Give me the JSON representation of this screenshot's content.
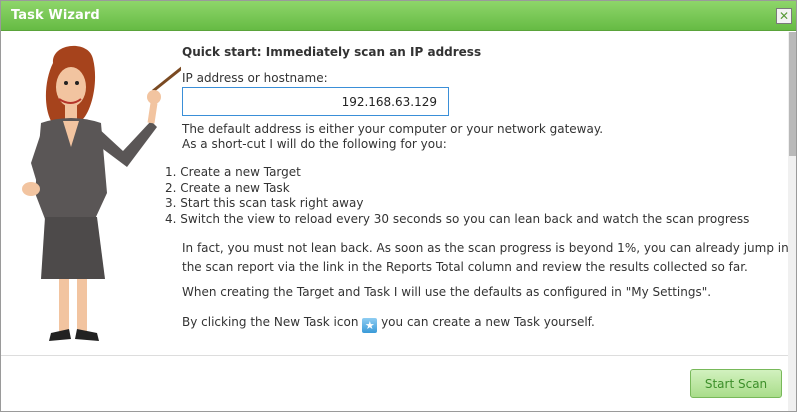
{
  "window": {
    "title": "Task Wizard",
    "close_glyph": "✕"
  },
  "main": {
    "heading": "Quick start: Immediately scan an IP address",
    "ip_label": "IP address or hostname:",
    "ip_value": "192.168.63.129",
    "default_note_1": "The default address is either your computer or your network gateway.",
    "default_note_2": "As a short-cut I will do the following for you:",
    "steps": [
      "Create a new Target",
      "Create a new Task",
      "Start this scan task right away",
      "Switch the view to reload every 30 seconds so you can lean back and watch the scan progress"
    ],
    "infact_1": "In fact, you must not lean back. As soon as the scan progress is beyond 1%, you can already jump into",
    "infact_2": "the scan report via the link in the Reports Total column and review the results collected so far.",
    "defaults_note": "When creating the Target and Task I will use the defaults as configured in \"My Settings\".",
    "newtask_before": "By clicking the New Task icon",
    "newtask_after": "you can create a new Task yourself.",
    "newtask_icon": "new-task-icon"
  },
  "footer": {
    "start_label": "Start Scan"
  },
  "colors": {
    "titlebar": "#66bb44",
    "button_text": "#3d8f2a",
    "input_border": "#3a8fd8"
  }
}
